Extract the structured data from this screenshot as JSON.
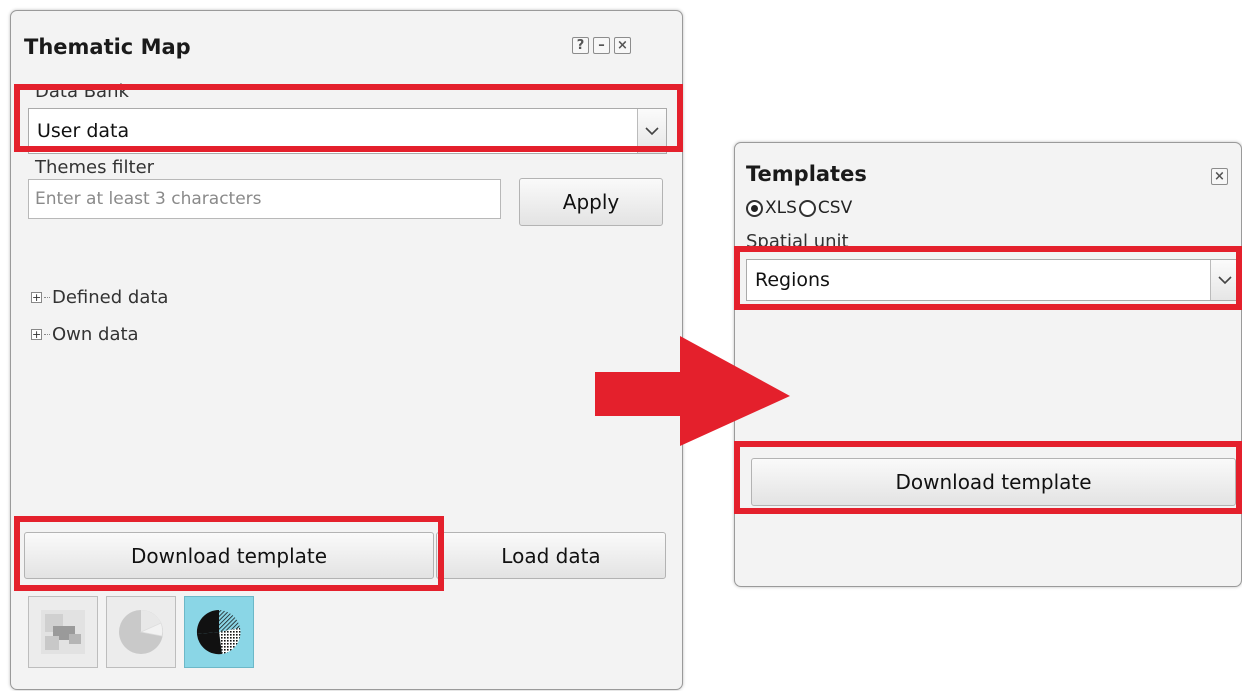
{
  "thematic_map": {
    "title": "Thematic Map",
    "data_bank_label": "Data Bank",
    "data_bank_value": "User data",
    "themes_filter_label": "Themes filter",
    "filter_placeholder": "Enter at least 3 characters",
    "apply_label": "Apply",
    "tree": [
      {
        "label": "Defined data"
      },
      {
        "label": "Own data"
      }
    ],
    "download_template_label": "Download template",
    "load_data_label": "Load data",
    "help_glyph": "?",
    "minimize_glyph": "–",
    "close_glyph": "×",
    "viz_buttons": [
      "choropleth-icon",
      "pie-chart-icon",
      "hatched-pie-icon"
    ]
  },
  "templates": {
    "title": "Templates",
    "format_options": [
      "XLS",
      "CSV"
    ],
    "selected_format": "XLS",
    "spatial_unit_label": "Spatial unit",
    "spatial_unit_value": "Regions",
    "download_template_label": "Download template",
    "close_glyph": "×"
  },
  "colors": {
    "highlight": "#e4202c",
    "arrow": "#e4202c",
    "active_viz": "#8ad6e6"
  }
}
